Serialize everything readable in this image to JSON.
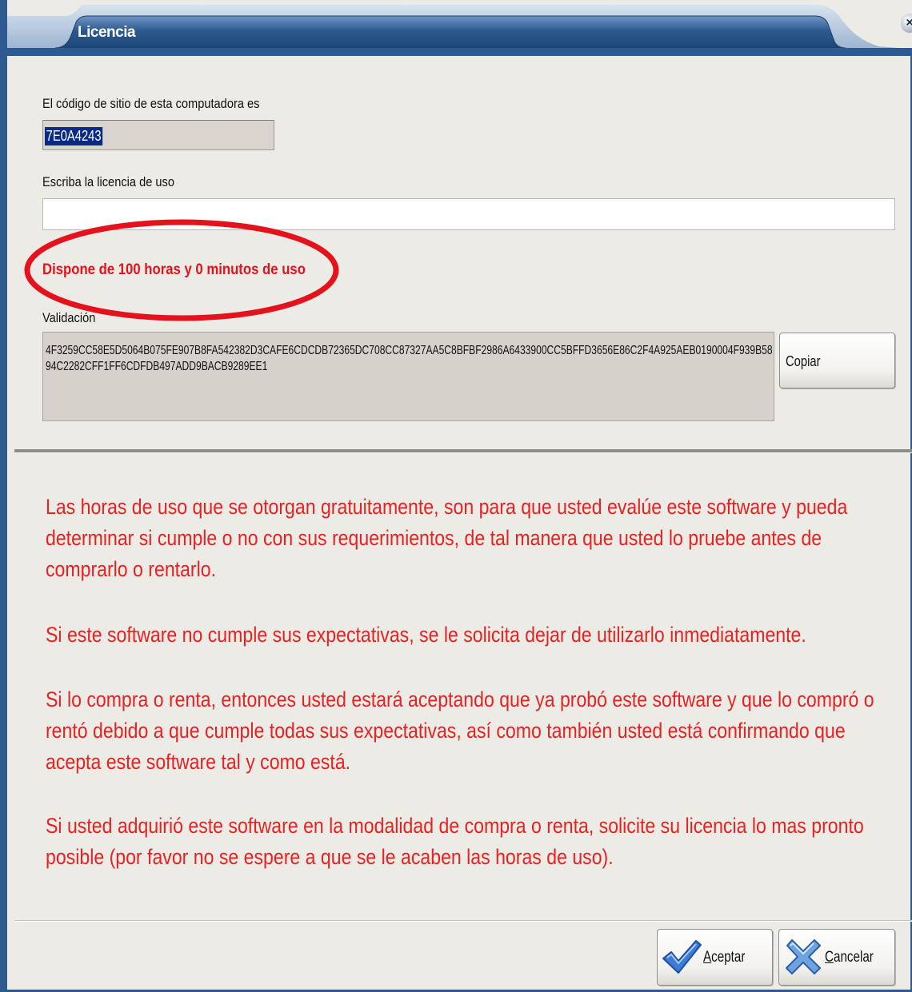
{
  "window": {
    "title": "Licencia",
    "close_icon": "×"
  },
  "site_code": {
    "label": "El código de sitio de esta computadora es",
    "value": "7E0A4243"
  },
  "license": {
    "label": "Escriba la licencia de uso",
    "value": ""
  },
  "hours_notice": "Dispone de 100 horas y 0 minutos de uso",
  "validation": {
    "label": "Validación",
    "value": "4F3259CC58E5D5064B075FE907B8FA542382D3CAFE6CDCDB72365DC708CC87327AA5C8BFBF2986A6433900CC5BFFD3656E86C2F4A925AEB0190004F939B5894C2282CFF1FF6CDFDB497ADD9BACB9289EE1",
    "copy_button": "Copiar"
  },
  "notice": {
    "paragraphs": [
      "Las horas de uso que se otorgan gratuitamente, son para que usted evalúe este software y pueda determinar si cumple o no con sus requerimientos, de tal manera que usted lo pruebe antes de comprarlo o rentarlo.",
      "Si este software no cumple sus expectativas, se le solicita dejar de utilizarlo inmediatamente.",
      "Si lo compra o renta, entonces usted estará aceptando que ya probó este software y que lo compró o rentó debido a que cumple todas sus expectativas, así como también usted está confirmando que acepta este software tal y como está.",
      "Si usted adquirió este software en la modalidad de compra o renta, solicite su licencia lo mas pronto posible (por favor no se espere a que se le acaben las horas de uso)."
    ]
  },
  "footer": {
    "accept_mnemonic": "A",
    "accept_rest": "ceptar",
    "accept_icon": "check-icon",
    "cancel_mnemonic": "C",
    "cancel_rest": "ancelar",
    "cancel_icon": "cross-icon"
  },
  "colors": {
    "titlebar": "#2d5b8f",
    "notice_red": "#e62223",
    "highlight_ellipse": "#e3121d"
  }
}
